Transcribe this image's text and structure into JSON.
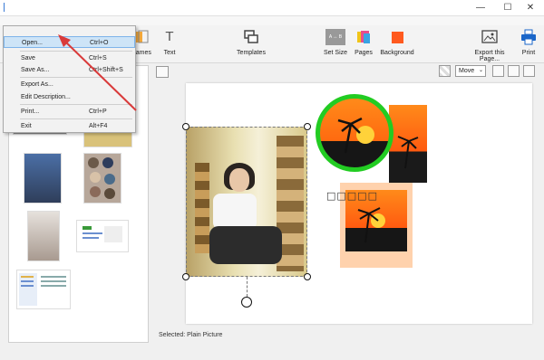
{
  "window": {
    "minimize": "—",
    "maximize": "☐",
    "close": "✕"
  },
  "toolbar": {
    "frames": "Frames",
    "text": "Text",
    "templates": "Templates",
    "set_size": "Set Size",
    "pages": "Pages",
    "background": "Background",
    "export": "Export this Page...",
    "print": "Print",
    "text_icon": "T",
    "set_size_icon": "A ↔ B"
  },
  "right_controls": {
    "mode": "Move"
  },
  "menu": {
    "items": [
      {
        "label": "Open...",
        "shortcut": "Ctrl+O"
      },
      {
        "label": "Save",
        "shortcut": "Ctrl+S"
      },
      {
        "label": "Save As...",
        "shortcut": "Ctrl+Shift+S"
      },
      {
        "label": "Export As..."
      },
      {
        "label": "Edit Description..."
      },
      {
        "label": "Print...",
        "shortcut": "Ctrl+P"
      },
      {
        "label": "Exit",
        "shortcut": "Alt+F4"
      }
    ]
  },
  "canvas": {
    "text_box": "□□□□□"
  },
  "status": {
    "text": "Selected: Plain Picture"
  },
  "colors": {
    "accent": "#3a7bd5",
    "background_swatch": "#ff5a1f",
    "circle_frame": "#22cc22",
    "arrow": "#d93a3a"
  }
}
